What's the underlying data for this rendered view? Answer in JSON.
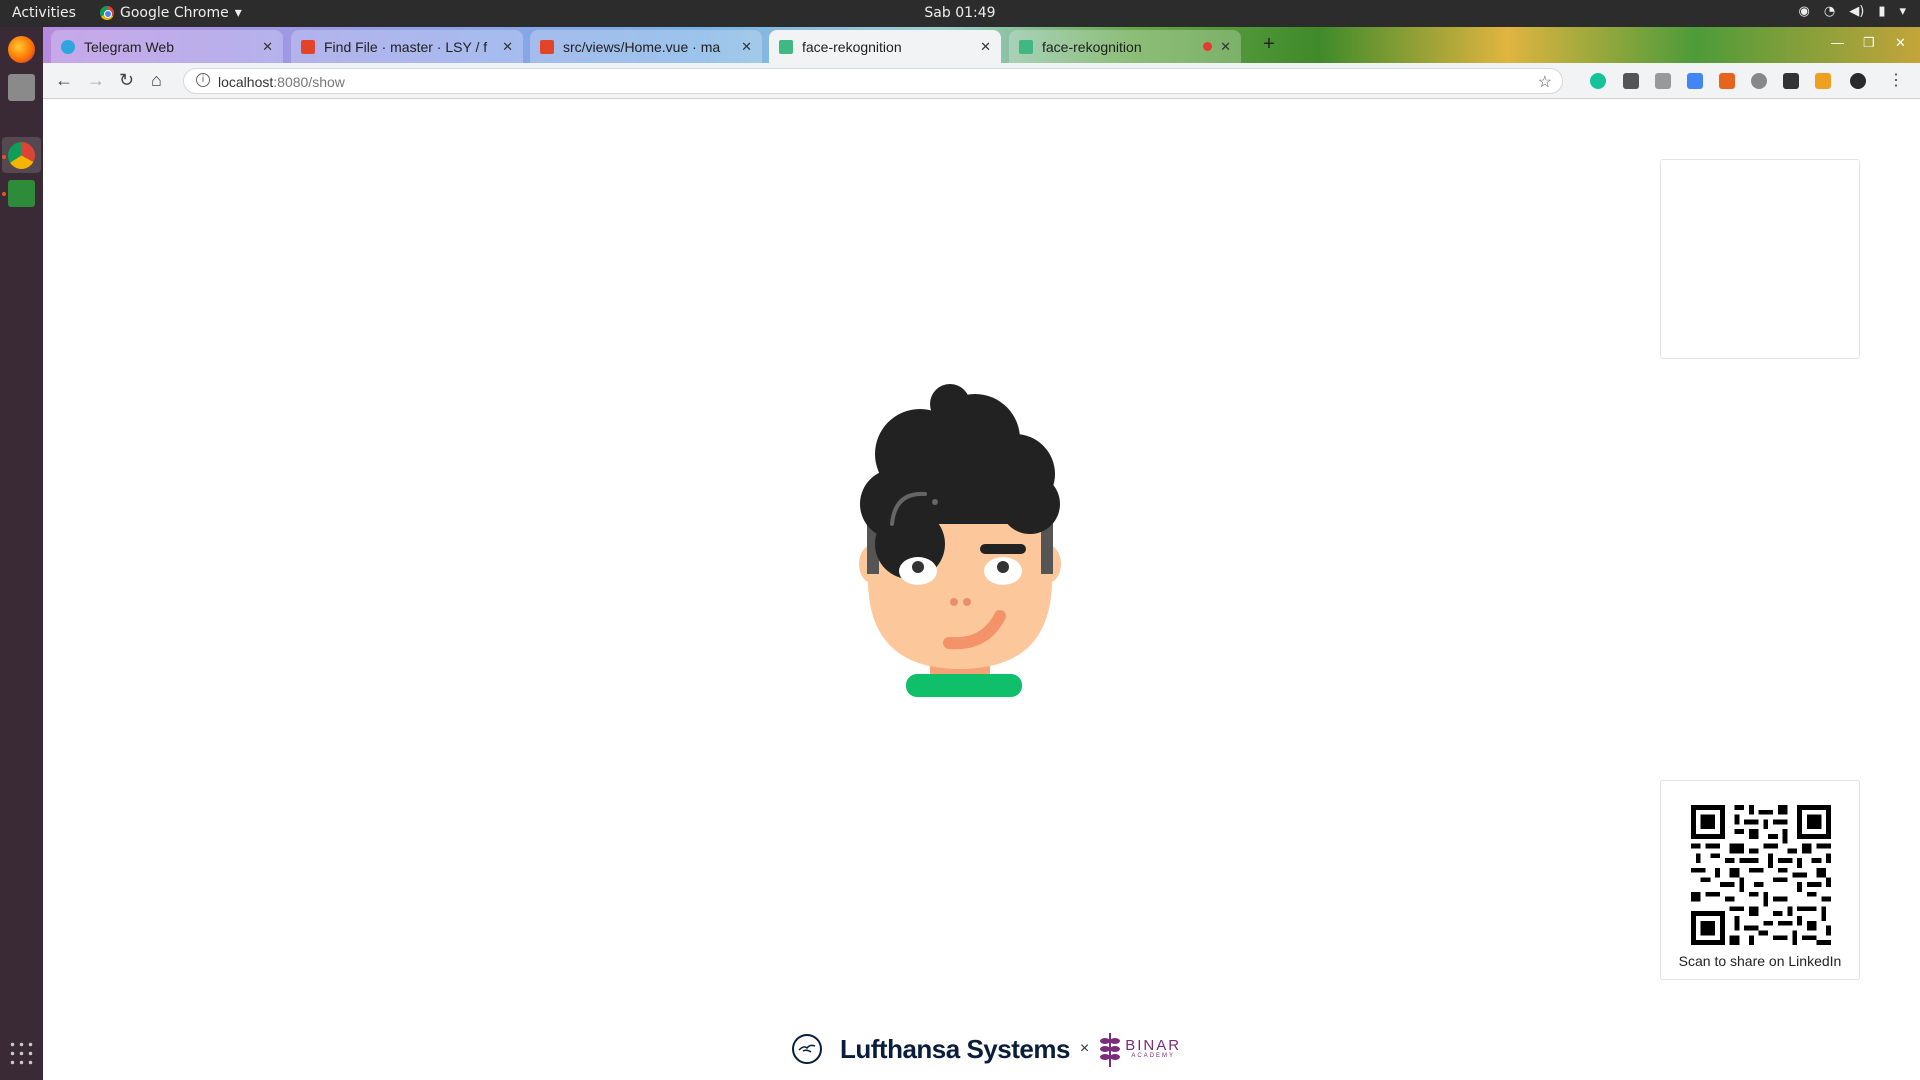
{
  "system": {
    "activities": "Activities",
    "app_menu": "Google Chrome",
    "clock": "Sab 01:49"
  },
  "browser": {
    "tabs": [
      {
        "title": "Telegram Web",
        "favicon": "telegram-icon",
        "color": "#2ca5e0"
      },
      {
        "title": "Find File · master · LSY / f",
        "favicon": "gitlab-icon",
        "color": "#e24329"
      },
      {
        "title": "src/views/Home.vue · ma",
        "favicon": "gitlab-icon",
        "color": "#e24329"
      },
      {
        "title": "face-rekognition",
        "favicon": "vue-icon",
        "color": "#41b883"
      },
      {
        "title": "face-rekognition",
        "favicon": "vue-icon",
        "color": "#41b883"
      }
    ],
    "active_tab": 3,
    "url_host": "localhost",
    "url_path": ":8080/show"
  },
  "page": {
    "qr_caption": "Scan to share on LinkedIn",
    "footer": {
      "brand": "Lufthansa Systems",
      "separator": "×",
      "partner": "BINAR",
      "partner_sub": "ACADEMY"
    }
  },
  "colors": {
    "hair": "#222222",
    "skin": "#fcc79b",
    "collar": "#0fbf6a",
    "accent": "#0a1d3d",
    "partner": "#7a2d7a"
  }
}
